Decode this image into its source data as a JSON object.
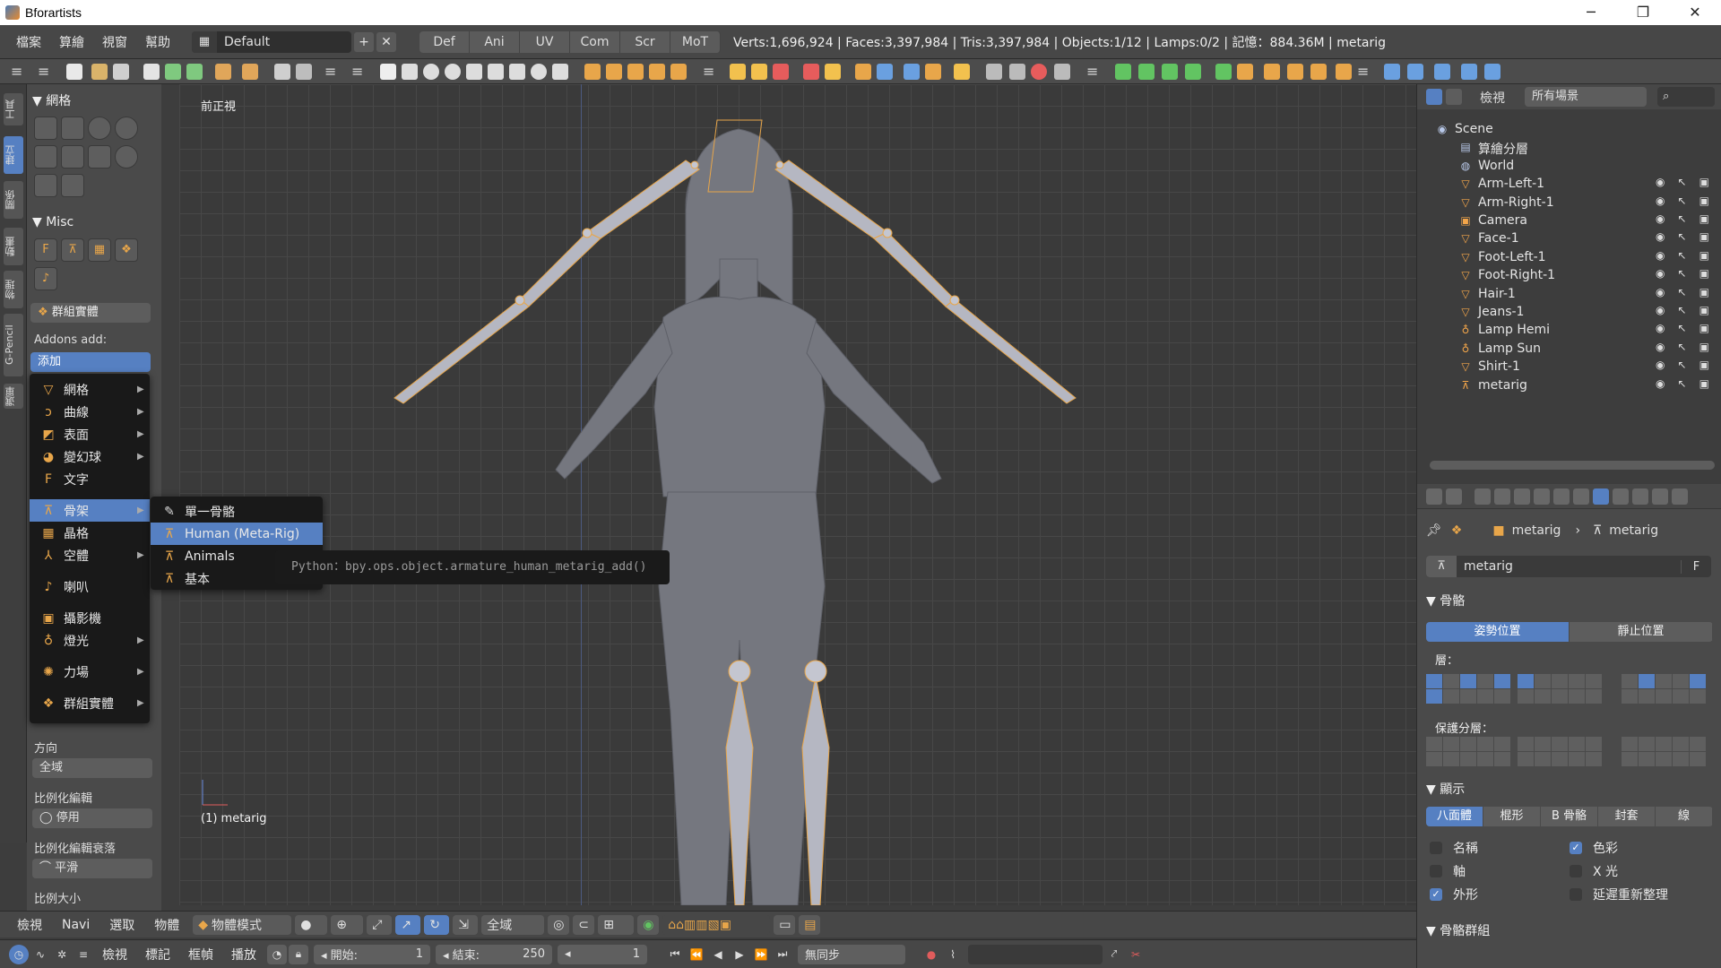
{
  "titlebar": {
    "title": "Bforartists"
  },
  "infobar": {
    "menus": [
      "檔案",
      "算繪",
      "視窗",
      "幫助"
    ],
    "screen": "Default",
    "workspaces": [
      "Def",
      "Ani",
      "UV",
      "Com",
      "Scr",
      "MoT"
    ],
    "stats": "Verts:1,696,924 | Faces:3,397,984 | Tris:3,397,984 | Objects:1/12 | Lamps:0/2 | 記憶：884.36M | metarig"
  },
  "lefttabs": [
    "工具",
    "建立",
    "關係",
    "動畫",
    "物理",
    "G-Pencil",
    "選單"
  ],
  "toolshelf": {
    "mesh_panel": "網格",
    "misc_panel": "Misc",
    "group_instance": "群組實體",
    "addons_label": "Addons add:",
    "add_select": "添加",
    "direction_label": "方向",
    "direction_value": "全域",
    "prop_edit_label": "比例化編輯",
    "prop_edit_value": "停用",
    "falloff_label": "比例化編輯衰落",
    "falloff_value": "平滑",
    "prop_size_label": "比例大小",
    "partial_labels": [
      "向",
      "約"
    ]
  },
  "addmenu": {
    "items": [
      {
        "label": "網格",
        "icon": "mesh-icon"
      },
      {
        "label": "曲線",
        "icon": "curve-icon"
      },
      {
        "label": "表面",
        "icon": "surface-icon"
      },
      {
        "label": "變幻球",
        "icon": "metaball-icon"
      },
      {
        "label": "文字",
        "icon": "text-icon"
      },
      {
        "label": "骨架",
        "icon": "armature-icon"
      },
      {
        "label": "晶格",
        "icon": "lattice-icon"
      },
      {
        "label": "空體",
        "icon": "empty-icon"
      },
      {
        "label": "喇叭",
        "icon": "speaker-icon"
      },
      {
        "label": "攝影機",
        "icon": "camera-icon"
      },
      {
        "label": "燈光",
        "icon": "lamp-icon"
      },
      {
        "label": "力場",
        "icon": "forcefield-icon"
      },
      {
        "label": "群組實體",
        "icon": "group-icon"
      }
    ],
    "submenu": [
      "單一骨骼",
      "Human (Meta-Rig)",
      "Animals",
      "基本"
    ],
    "tooltip": "Python：bpy.ops.object.armature_human_metarig_add()"
  },
  "viewport": {
    "view_name": "前正視",
    "object_label": "(1) metarig"
  },
  "vpheader": {
    "menus": [
      "檢視",
      "Navi",
      "選取",
      "物體"
    ],
    "mode": "物體模式",
    "orientation": "全域"
  },
  "timeline": {
    "menus": [
      "檢視",
      "標記",
      "框幀",
      "播放"
    ],
    "start_label": "開始:",
    "start_value": "1",
    "end_label": "結束:",
    "end_value": "250",
    "current": "1",
    "sync": "無同步"
  },
  "outliner": {
    "view_label": "檢視",
    "filter": "所有場景",
    "rows": [
      {
        "name": "Scene",
        "icon": "scene-icon",
        "vis": false
      },
      {
        "name": "算繪分層",
        "icon": "renderlayer-icon",
        "vis": false
      },
      {
        "name": "World",
        "icon": "world-icon",
        "vis": false
      },
      {
        "name": "Arm-Left-1",
        "icon": "mesh-icon",
        "vis": true
      },
      {
        "name": "Arm-Right-1",
        "icon": "mesh-icon",
        "vis": true
      },
      {
        "name": "Camera",
        "icon": "camera-icon",
        "vis": true
      },
      {
        "name": "Face-1",
        "icon": "mesh-icon",
        "vis": true
      },
      {
        "name": "Foot-Left-1",
        "icon": "mesh-icon",
        "vis": true
      },
      {
        "name": "Foot-Right-1",
        "icon": "mesh-icon",
        "vis": true
      },
      {
        "name": "Hair-1",
        "icon": "mesh-icon",
        "vis": true
      },
      {
        "name": "Jeans-1",
        "icon": "mesh-icon",
        "vis": true
      },
      {
        "name": "Lamp Hemi",
        "icon": "lamp-icon",
        "vis": true
      },
      {
        "name": "Lamp Sun",
        "icon": "lamp-icon",
        "vis": true
      },
      {
        "name": "Shirt-1",
        "icon": "mesh-icon",
        "vis": true
      },
      {
        "name": "metarig",
        "icon": "armature-icon",
        "vis": true
      }
    ]
  },
  "props": {
    "breadcrumb_a": "metarig",
    "breadcrumb_b": "metarig",
    "name_field": "metarig",
    "fake_user": "F",
    "skeleton_panel": "骨骼",
    "pose_position": "姿勢位置",
    "rest_position": "靜止位置",
    "layers_label": "層：",
    "protected_label": "保護分層：",
    "display_panel": "顯示",
    "display_types": [
      "八面體",
      "棍形",
      "B 骨骼",
      "封套",
      "線"
    ],
    "checks": [
      {
        "label": "名稱",
        "on": false
      },
      {
        "label": "色彩",
        "on": true
      },
      {
        "label": "軸",
        "on": false
      },
      {
        "label": "X 光",
        "on": false
      },
      {
        "label": "外形",
        "on": true
      },
      {
        "label": "延遲重新整理",
        "on": false
      }
    ],
    "bone_groups_panel": "骨骼群組"
  },
  "colors": {
    "accent": "#5680c2",
    "icon_orange": "#e8a64a",
    "bone": "#b0b0bc",
    "mesh": "#767883"
  }
}
